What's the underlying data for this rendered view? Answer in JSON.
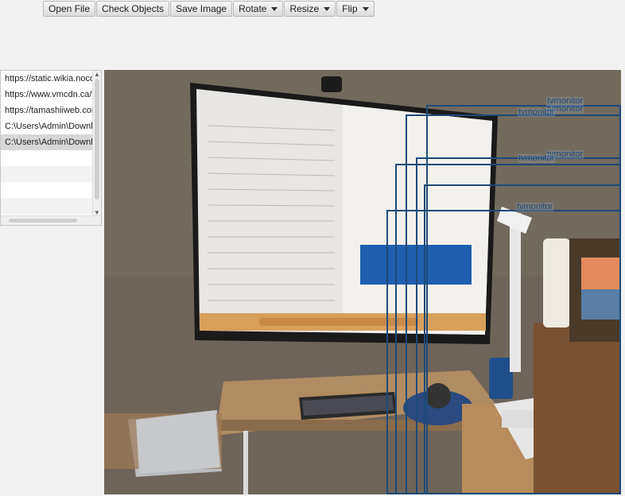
{
  "toolbar": {
    "open_file": "Open File",
    "check_objects": "Check Objects",
    "save_image": "Save Image",
    "rotate": "Rotate",
    "resize": "Resize",
    "flip": "Flip"
  },
  "files": [
    "https://static.wikia.nocookie",
    "https://www.vmcdn.ca/f/",
    "https://tamashiiweb.com",
    "C:\\Users\\Admin\\Downloads",
    "C:\\Users\\Admin\\Downloads"
  ],
  "detections": [
    {
      "label": "tvmonitor"
    },
    {
      "label": "tvmonitor"
    },
    {
      "label": "tvmonitor"
    },
    {
      "label": "tvmonitor"
    },
    {
      "label": "tvmonitor"
    },
    {
      "label": "tvmonitor"
    }
  ],
  "colors": {
    "bbox": "#1e4a78",
    "selected_row": "#d7d7d7"
  }
}
